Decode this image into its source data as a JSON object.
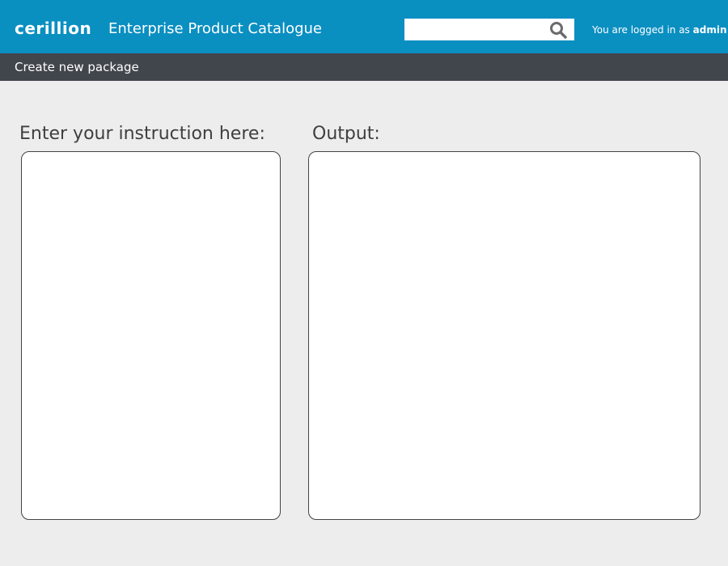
{
  "header": {
    "logo_text": "cerillion",
    "app_title": "Enterprise Product Catalogue",
    "search": {
      "value": "",
      "placeholder": ""
    },
    "login": {
      "prefix": "You are logged in as",
      "user": "admin"
    }
  },
  "subheader": {
    "title": "Create new package"
  },
  "panels": {
    "instruction": {
      "label": "Enter your instruction here:",
      "value": ""
    },
    "output": {
      "label": "Output:",
      "value": ""
    }
  },
  "colors": {
    "header_bg": "#0a8fc1",
    "subheader_bg": "#41454c",
    "page_bg": "#ededed",
    "panel_border": "#444444"
  },
  "icons": {
    "search": "search-icon"
  }
}
